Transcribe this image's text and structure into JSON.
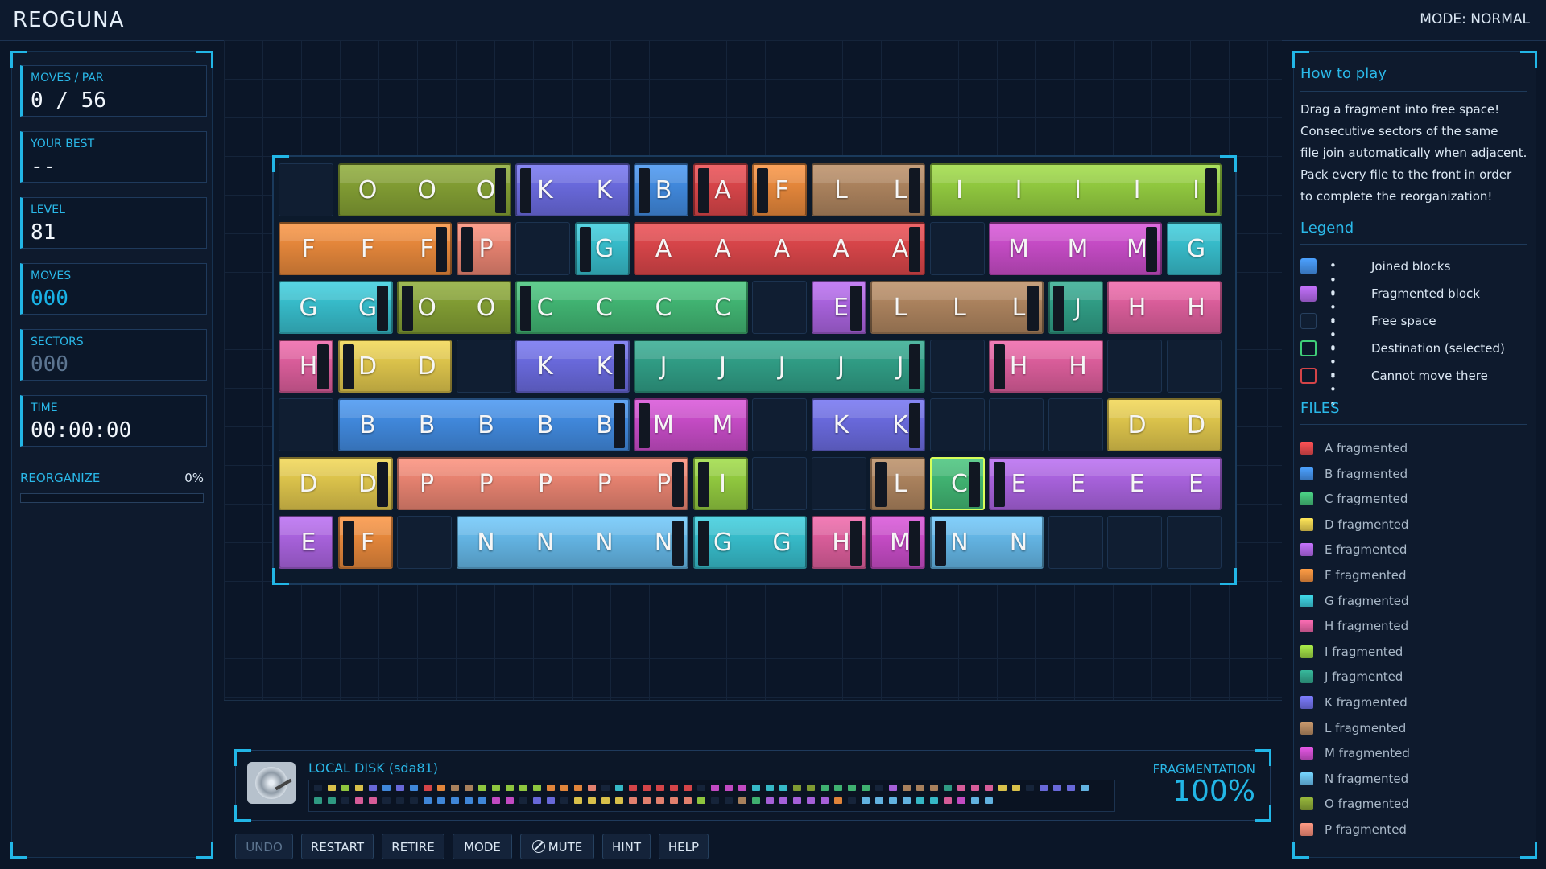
{
  "app_title": "REOGUNA",
  "mode_label": "MODE: NORMAL",
  "stats": [
    {
      "label": "MOVES / PAR",
      "value": "0 / 56",
      "style": "white"
    },
    {
      "label": "YOUR BEST",
      "value": "--",
      "style": "white"
    },
    {
      "label": "LEVEL",
      "value": "81",
      "style": "white"
    },
    {
      "label": "MOVES",
      "value": "000",
      "style": "cyan"
    },
    {
      "label": "SECTORS",
      "value": "000",
      "style": "dim"
    },
    {
      "label": "TIME",
      "value": "00:00:00",
      "style": "white"
    }
  ],
  "reorganize": {
    "label": "REORGANIZE",
    "percent_text": "0%",
    "progress": 0
  },
  "board": {
    "rows": 7,
    "cols": 16,
    "blocks": [
      {
        "row": 0,
        "start": 1,
        "len": 3,
        "file": "O",
        "tab": "r"
      },
      {
        "row": 0,
        "start": 4,
        "len": 2,
        "file": "K",
        "tab": "l"
      },
      {
        "row": 0,
        "start": 6,
        "len": 1,
        "file": "B",
        "tab": "l"
      },
      {
        "row": 0,
        "start": 7,
        "len": 1,
        "file": "A",
        "tab": "l"
      },
      {
        "row": 0,
        "start": 8,
        "len": 1,
        "file": "F",
        "tab": "l"
      },
      {
        "row": 0,
        "start": 9,
        "len": 2,
        "file": "L",
        "tab": "r"
      },
      {
        "row": 0,
        "start": 11,
        "len": 5,
        "file": "I",
        "tab": "r"
      },
      {
        "row": 1,
        "start": 0,
        "len": 3,
        "file": "F",
        "tab": "r"
      },
      {
        "row": 1,
        "start": 3,
        "len": 1,
        "file": "P",
        "tab": "l"
      },
      {
        "row": 1,
        "start": 5,
        "len": 1,
        "file": "G",
        "tab": "l"
      },
      {
        "row": 1,
        "start": 6,
        "len": 5,
        "file": "A",
        "tab": "r"
      },
      {
        "row": 1,
        "start": 12,
        "len": 3,
        "file": "M",
        "tab": "r"
      },
      {
        "row": 1,
        "start": 15,
        "len": 1,
        "file": "G",
        "tab": ""
      },
      {
        "row": 2,
        "start": 0,
        "len": 2,
        "file": "G",
        "tab": "r"
      },
      {
        "row": 2,
        "start": 2,
        "len": 2,
        "file": "O",
        "tab": "l"
      },
      {
        "row": 2,
        "start": 4,
        "len": 4,
        "file": "C",
        "tab": "l"
      },
      {
        "row": 2,
        "start": 9,
        "len": 1,
        "file": "E",
        "tab": "r"
      },
      {
        "row": 2,
        "start": 10,
        "len": 3,
        "file": "L",
        "tab": "r"
      },
      {
        "row": 2,
        "start": 13,
        "len": 1,
        "file": "J",
        "tab": "l"
      },
      {
        "row": 2,
        "start": 14,
        "len": 2,
        "file": "H",
        "tab": ""
      },
      {
        "row": 3,
        "start": 0,
        "len": 1,
        "file": "H",
        "tab": "r"
      },
      {
        "row": 3,
        "start": 1,
        "len": 2,
        "file": "D",
        "tab": "l"
      },
      {
        "row": 3,
        "start": 4,
        "len": 2,
        "file": "K",
        "tab": "r"
      },
      {
        "row": 3,
        "start": 6,
        "len": 5,
        "file": "J",
        "tab": "r"
      },
      {
        "row": 3,
        "start": 12,
        "len": 2,
        "file": "H",
        "tab": "l"
      },
      {
        "row": 4,
        "start": 1,
        "len": 5,
        "file": "B",
        "tab": "r"
      },
      {
        "row": 4,
        "start": 6,
        "len": 2,
        "file": "M",
        "tab": "l"
      },
      {
        "row": 4,
        "start": 9,
        "len": 2,
        "file": "K",
        "tab": "r"
      },
      {
        "row": 4,
        "start": 14,
        "len": 2,
        "file": "D",
        "tab": ""
      },
      {
        "row": 5,
        "start": 0,
        "len": 2,
        "file": "D",
        "tab": "r"
      },
      {
        "row": 5,
        "start": 2,
        "len": 5,
        "file": "P",
        "tab": "r"
      },
      {
        "row": 5,
        "start": 7,
        "len": 1,
        "file": "I",
        "tab": "l"
      },
      {
        "row": 5,
        "start": 10,
        "len": 1,
        "file": "L",
        "tab": "l"
      },
      {
        "row": 5,
        "start": 11,
        "len": 1,
        "file": "C",
        "tab": "r",
        "selected": true
      },
      {
        "row": 5,
        "start": 12,
        "len": 4,
        "file": "E",
        "tab": "l"
      },
      {
        "row": 6,
        "start": 0,
        "len": 1,
        "file": "E",
        "tab": ""
      },
      {
        "row": 6,
        "start": 1,
        "len": 1,
        "file": "F",
        "tab": "l"
      },
      {
        "row": 6,
        "start": 3,
        "len": 4,
        "file": "N",
        "tab": "r"
      },
      {
        "row": 6,
        "start": 7,
        "len": 2,
        "file": "G",
        "tab": "l"
      },
      {
        "row": 6,
        "start": 9,
        "len": 1,
        "file": "H",
        "tab": "r"
      },
      {
        "row": 6,
        "start": 10,
        "len": 1,
        "file": "M",
        "tab": "r"
      },
      {
        "row": 6,
        "start": 11,
        "len": 2,
        "file": "N",
        "tab": "l"
      }
    ]
  },
  "file_colors": {
    "A": "#d44448",
    "B": "#3f86d8",
    "C": "#3fb070",
    "D": "#d8c04a",
    "E": "#a560d8",
    "F": "#e0843a",
    "G": "#36b8c6",
    "H": "#d65c98",
    "I": "#8ec53e",
    "J": "#2f9a82",
    "K": "#6868d8",
    "L": "#a8805c",
    "M": "#c24ac2",
    "N": "#62b2e0",
    "O": "#7f9a32",
    "P": "#e2806e"
  },
  "disk": {
    "label": "LOCAL DISK (sda81)",
    "fragmentation_label": "FRAGMENTATION",
    "fragmentation_value": "100%",
    "map_row1": [
      "",
      "D",
      "I",
      "D",
      "K",
      "B",
      "K",
      "B",
      "A",
      "F",
      "L",
      "L",
      "I",
      "I",
      "I",
      "I",
      "I",
      "F",
      "F",
      "F",
      "P",
      "",
      "G",
      "A",
      "A",
      "A",
      "A",
      "A",
      "",
      "M",
      "M",
      "M",
      "G",
      "G",
      "G",
      "O",
      "O",
      "C",
      "C",
      "C",
      "C",
      "",
      "E",
      "L",
      "L",
      "L",
      "J",
      "H",
      "H",
      "H",
      "D",
      "D",
      "",
      "K",
      "K",
      "K",
      "N"
    ],
    "map_row2": [
      "J",
      "J",
      "",
      "H",
      "H",
      "",
      "",
      "",
      "B",
      "B",
      "B",
      "B",
      "B",
      "M",
      "M",
      "",
      "K",
      "K",
      "",
      "D",
      "D",
      "D",
      "D",
      "P",
      "P",
      "P",
      "P",
      "P",
      "I",
      "",
      "",
      "L",
      "C",
      "E",
      "E",
      "E",
      "E",
      "E",
      "F",
      "",
      "N",
      "N",
      "N",
      "N",
      "G",
      "G",
      "H",
      "M",
      "N",
      "N"
    ]
  },
  "buttons": [
    {
      "label": "UNDO",
      "enabled": false
    },
    {
      "label": "RESTART",
      "enabled": true
    },
    {
      "label": "RETIRE",
      "enabled": true
    },
    {
      "label": "MODE",
      "enabled": true
    },
    {
      "label": "MUTE",
      "enabled": true,
      "icon": "mute-icon"
    },
    {
      "label": "HINT",
      "enabled": true
    },
    {
      "label": "HELP",
      "enabled": true
    }
  ],
  "help": {
    "title": "How to play",
    "lines": [
      "Drag a fragment into free space!",
      "Consecutive sectors of the same",
      "file join automatically when adjacent.",
      "Pack every file to the front in order",
      "to complete the reorganization!"
    ]
  },
  "legend": {
    "title": "Legend",
    "items": [
      {
        "label": "Joined blocks",
        "swatch": "joined"
      },
      {
        "label": "Fragmented block",
        "swatch": "fragmented"
      },
      {
        "label": "Free space",
        "swatch": "free"
      },
      {
        "label": "Destination (selected)",
        "swatch": "destination"
      },
      {
        "label": "Cannot move there",
        "swatch": "blocked"
      }
    ],
    "dots": "• • •",
    "swatch_colors": {
      "joined": "#3f86d8",
      "fragmented": "#a560d8",
      "free": "#101e32",
      "destination": "#3fcf78",
      "blocked": "#d44448"
    }
  },
  "files": {
    "title": "FILES",
    "items": [
      {
        "letter": "A",
        "label": "A  fragmented"
      },
      {
        "letter": "B",
        "label": "B  fragmented"
      },
      {
        "letter": "C",
        "label": "C  fragmented"
      },
      {
        "letter": "D",
        "label": "D  fragmented"
      },
      {
        "letter": "E",
        "label": "E  fragmented"
      },
      {
        "letter": "F",
        "label": "F  fragmented"
      },
      {
        "letter": "G",
        "label": "G  fragmented"
      },
      {
        "letter": "H",
        "label": "H  fragmented"
      },
      {
        "letter": "I",
        "label": "I  fragmented"
      },
      {
        "letter": "J",
        "label": "J  fragmented"
      },
      {
        "letter": "K",
        "label": "K  fragmented"
      },
      {
        "letter": "L",
        "label": "L  fragmented"
      },
      {
        "letter": "M",
        "label": "M  fragmented"
      },
      {
        "letter": "N",
        "label": "N  fragmented"
      },
      {
        "letter": "O",
        "label": "O  fragmented"
      },
      {
        "letter": "P",
        "label": "P  fragmented"
      }
    ]
  }
}
